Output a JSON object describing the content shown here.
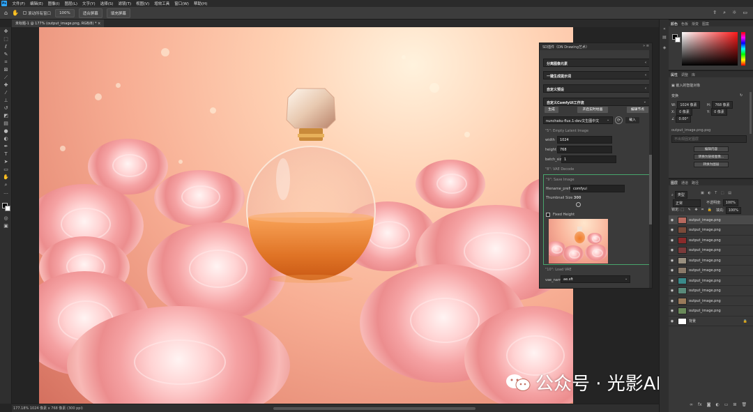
{
  "app": {
    "logo": "Ps"
  },
  "menubar": [
    "文件(F)",
    "编辑(E)",
    "图像(I)",
    "图层(L)",
    "文字(Y)",
    "选择(S)",
    "滤镜(T)",
    "视图(V)",
    "增效工具",
    "窗口(W)",
    "帮助(H)"
  ],
  "options": {
    "scroll_all": "滚动所有窗口",
    "zoom": "100%",
    "fit_screen": "适合屏幕",
    "fill_screen": "填充屏幕"
  },
  "document": {
    "tab_title": "未标题-1 @ 177% (output_image.png, RGB/8) *"
  },
  "status": {
    "text": "177.18%   1024 像素 x 768 像素 (300 ppi)"
  },
  "sd_panel": {
    "title": "SD插件（DN Drawing艺术）",
    "sections": [
      "分离图像元素",
      "一键生成提示词",
      "自定义预设",
      "自定义ComfyUI工作流"
    ],
    "btn_generate": "生成",
    "btn_realtime": "开启实时绘画",
    "btn_edit_node": "编辑节点",
    "model_select": "nunchaku-flux.1-dev文生图中文",
    "btn_load": "载入",
    "node_latent": "\"5\": Empty Latent Image",
    "width_label": "width",
    "width_value": "1024",
    "height_label": "height",
    "height_value": "768",
    "batch_label": "batch_size",
    "batch_value": "1",
    "node_vae": "\"8\": VAE Decode",
    "node_save": "\"9\": Save Image",
    "filename_label": "filename_prefix",
    "filename_value": "comfyui",
    "thumb_size_label": "Thumbnail Size",
    "thumb_size_value": "300",
    "fixed_height_label": "Fixed Height",
    "node_vae_load": "\"10\": Load VAE",
    "vae_name_label": "vae_name",
    "vae_name_value": "ae.sft"
  },
  "color_panel": {
    "tabs": [
      "颜色",
      "色板",
      "渐变",
      "图案"
    ],
    "fg": "#000000",
    "bg": "#ffffff",
    "field_hue": "#ff1a1a"
  },
  "properties": {
    "tabs": [
      "属性",
      "调整",
      "库"
    ],
    "object_type": "嵌入的智能对象",
    "transform_label": "变换",
    "w_label": "W:",
    "w_value": "1024 像素",
    "h_label": "H:",
    "h_value": "768 像素",
    "x_label": "X:",
    "x_value": "0 像素",
    "y_label": "Y:",
    "y_value": "0 像素",
    "angle_value": "0.00°",
    "file": "output_image.png.psg",
    "placeholder": "不出现固定图层",
    "btn_edit": "编辑内容",
    "btn_convert_layers": "转换为链接图像...",
    "btn_convert_object": "转换为图层"
  },
  "layers_panel": {
    "tabs": [
      "图层",
      "通道",
      "路径"
    ],
    "kind_label": "类型",
    "blend_mode": "正常",
    "opacity_label": "不透明度:",
    "opacity_value": "100%",
    "lock_label": "锁定:",
    "fill_label": "填充:",
    "fill_value": "100%",
    "layers": [
      {
        "name": "output_image.png",
        "selected": true
      },
      {
        "name": "output_image.png"
      },
      {
        "name": "output_image.png"
      },
      {
        "name": "output_image.png"
      },
      {
        "name": "output_image.png"
      },
      {
        "name": "output_image.png"
      },
      {
        "name": "output_image.png"
      },
      {
        "name": "output_image.png"
      },
      {
        "name": "output_image.png"
      },
      {
        "name": "output_image.png"
      }
    ],
    "background_layer": "背景"
  },
  "watermark": {
    "text": "公众号 · 光影AI艺术"
  }
}
